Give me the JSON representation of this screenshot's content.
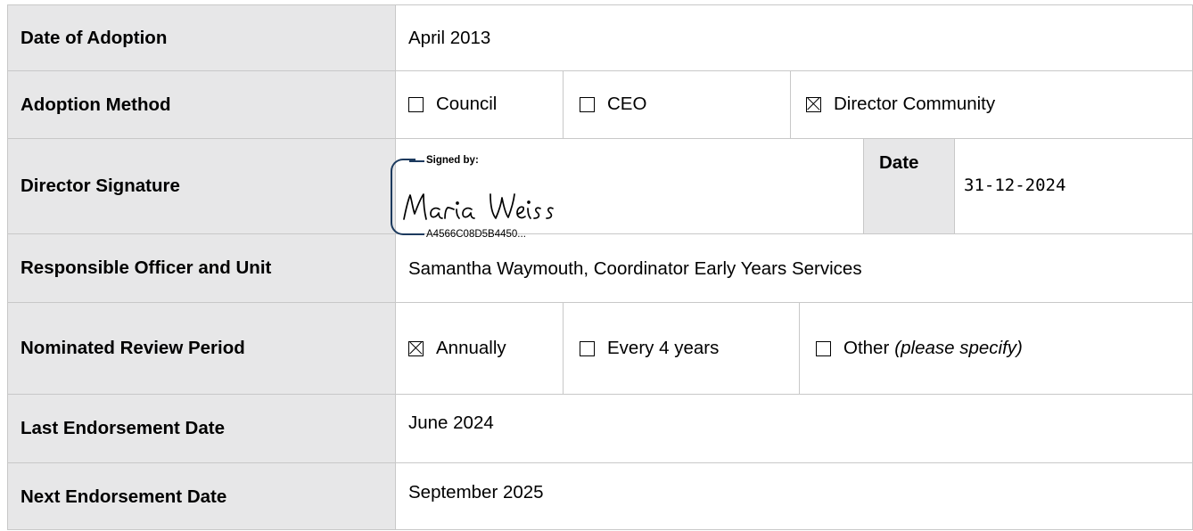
{
  "rows": {
    "adoption_date": {
      "label": "Date of Adoption",
      "value": "April 2013"
    },
    "adoption_method": {
      "label": "Adoption Method",
      "options": [
        {
          "label": "Council",
          "checked": false
        },
        {
          "label": "CEO",
          "checked": false
        },
        {
          "label": "Director Community",
          "checked": true
        }
      ]
    },
    "director_signature": {
      "label": "Director Signature",
      "signed_by": "Signed by:",
      "signer_name": "Maria Weiss",
      "envelope_id": "A4566C08D5B4450...",
      "date_label": "Date",
      "date_value": "31-12-2024"
    },
    "responsible_officer": {
      "label": "Responsible Officer and Unit",
      "value": "Samantha Waymouth, Coordinator Early Years Services"
    },
    "review_period": {
      "label": "Nominated Review Period",
      "options": [
        {
          "label": "Annually",
          "checked": true
        },
        {
          "label": "Every 4 years",
          "checked": false
        },
        {
          "label": "Other",
          "note": "(please specify)",
          "checked": false
        }
      ]
    },
    "last_endorsement": {
      "label": "Last Endorsement Date",
      "value": "June 2024"
    },
    "next_endorsement": {
      "label": "Next Endorsement Date",
      "value": "September 2025"
    }
  },
  "colors": {
    "label_background": "#e7e7e8",
    "border": "#c8c8c8",
    "signature_box": "#1c3a5e"
  }
}
